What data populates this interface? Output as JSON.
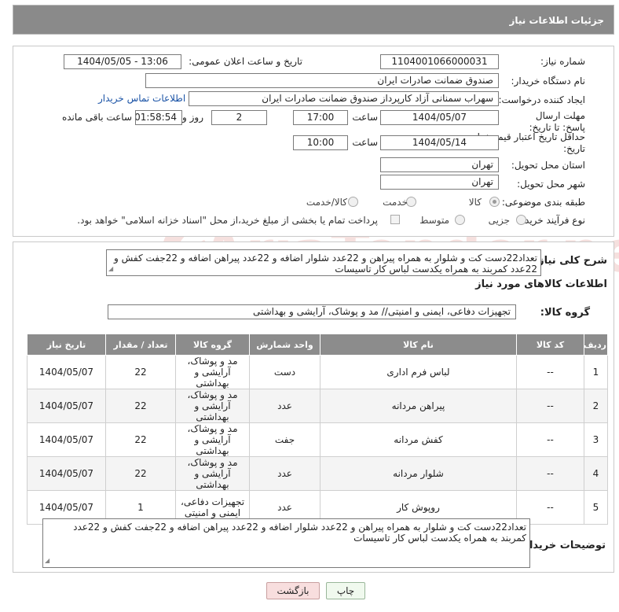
{
  "header": {
    "title": "جزئیات اطلاعات نیاز"
  },
  "watermark": {
    "text": "AriaTender.neT"
  },
  "form": {
    "need_number_label": "شماره نیاز:",
    "need_number": "1104001066000031",
    "announce_label": "تاریخ و ساعت اعلان عمومی:",
    "announce_value": "1404/05/05 - 13:06",
    "buyer_org_label": "نام دستگاه خریدار:",
    "buyer_org": "صندوق ضمانت صادرات ایران",
    "requester_label": "ایجاد کننده درخواست:",
    "requester": "سهراب سمنانی آزاد کارپرداز صندوق ضمانت صادرات ایران",
    "contact_link": "اطلاعات تماس خریدار",
    "deadline_label": "مهلت ارسال پاسخ: تا تاریخ:",
    "deadline_date": "1404/05/07",
    "time_label": "ساعت",
    "deadline_time": "17:00",
    "days_value": "2",
    "days_label": "روز و",
    "remaining_value": "01:58:54",
    "remaining_label": "ساعت باقی مانده",
    "validity_label": "حداقل تاریخ اعتبار قیمت: تا تاریخ:",
    "validity_date": "1404/05/14",
    "validity_time": "10:00",
    "province_label": "استان محل تحویل:",
    "province": "تهران",
    "city_label": "شهر محل تحویل:",
    "city": "تهران",
    "category_label": "طبقه بندی موضوعی:",
    "category_options": [
      "کالا",
      "خدمت",
      "کالا/خدمت"
    ],
    "process_label": "نوع فرآیند خرید :",
    "process_options": [
      "جزیی",
      "متوسط"
    ],
    "payment_note": "پرداخت تمام یا بخشی از مبلغ خرید،از محل \"اسناد خزانه اسلامی\" خواهد بود."
  },
  "details": {
    "summary_label": "شرح کلی نیاز:",
    "summary": "تعداد22دست کت و شلوار به همراه پیراهن و 22عدد شلوار اضافه و 22عدد پیراهن اضافه و 22جفت کفش و 22عدد کمربند به همراه یکدست لباس کار تاسیسات",
    "goods_info_title": "اطلاعات کالاهای مورد نیاز",
    "goods_group_label": "گروه کالا:",
    "goods_group": "تجهیزات دفاعی، ایمنی و امنیتی// مد و پوشاک، آرایشی و بهداشتی",
    "table": {
      "headers": [
        "ردیف",
        "کد کالا",
        "نام کالا",
        "واحد شمارش",
        "گروه کالا",
        "تعداد / مقدار",
        "تاریخ نیاز"
      ],
      "rows": [
        [
          "1",
          "--",
          "لباس فرم اداری",
          "دست",
          "مد و پوشاک، آرایشی و بهداشتی",
          "22",
          "1404/05/07"
        ],
        [
          "2",
          "--",
          "پیراهن مردانه",
          "عدد",
          "مد و پوشاک، آرایشی و بهداشتی",
          "22",
          "1404/05/07"
        ],
        [
          "3",
          "--",
          "کفش مردانه",
          "جفت",
          "مد و پوشاک، آرایشی و بهداشتی",
          "22",
          "1404/05/07"
        ],
        [
          "4",
          "--",
          "شلوار مردانه",
          "عدد",
          "مد و پوشاک، آرایشی و بهداشتی",
          "22",
          "1404/05/07"
        ],
        [
          "5",
          "--",
          "روپوش کار",
          "عدد",
          "تجهیزات دفاعی، ایمنی و امنیتی",
          "1",
          "1404/05/07"
        ]
      ]
    },
    "buyer_notes_label": "توضیحات خریدار:",
    "buyer_notes": "تعداد22دست کت و شلوار به همراه پیراهن و 22عدد شلوار اضافه و 22عدد پیراهن اضافه و 22جفت کفش و 22عدد کمربند به همراه یکدست لباس کار تاسیسات"
  },
  "buttons": {
    "print": "چاپ",
    "back": "بازگشت"
  }
}
